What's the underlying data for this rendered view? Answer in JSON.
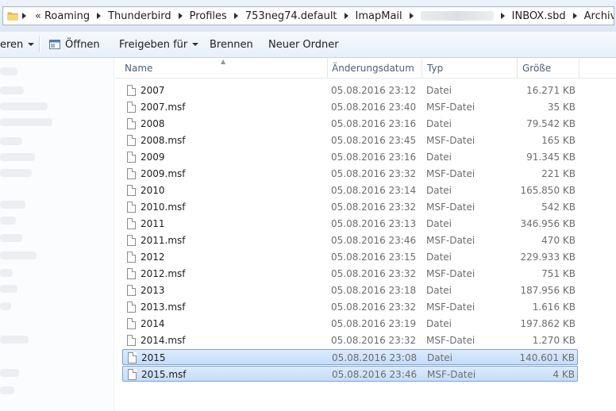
{
  "address": {
    "overflow_chevron": "«",
    "crumbs": [
      "Roaming",
      "Thunderbird",
      "Profiles",
      "753neg74.default",
      "ImapMail",
      "",
      "INBOX.sbd",
      "Archives.sbd"
    ]
  },
  "toolbar": {
    "organize_partial": "eren",
    "open_label": "Öffnen",
    "share_label": "Freigeben für",
    "burn_label": "Brennen",
    "new_folder_label": "Neuer Ordner"
  },
  "columns": {
    "name": "Name",
    "date": "Änderungsdatum",
    "type": "Typ",
    "size": "Größe"
  },
  "files": [
    {
      "name": "2007",
      "date": "05.08.2016 23:12",
      "type": "Datei",
      "size": "16.271 KB",
      "selected": false
    },
    {
      "name": "2007.msf",
      "date": "05.08.2016 23:40",
      "type": "MSF-Datei",
      "size": "35 KB",
      "selected": false
    },
    {
      "name": "2008",
      "date": "05.08.2016 23:16",
      "type": "Datei",
      "size": "79.542 KB",
      "selected": false
    },
    {
      "name": "2008.msf",
      "date": "05.08.2016 23:45",
      "type": "MSF-Datei",
      "size": "165 KB",
      "selected": false
    },
    {
      "name": "2009",
      "date": "05.08.2016 23:16",
      "type": "Datei",
      "size": "91.345 KB",
      "selected": false
    },
    {
      "name": "2009.msf",
      "date": "05.08.2016 23:32",
      "type": "MSF-Datei",
      "size": "221 KB",
      "selected": false
    },
    {
      "name": "2010",
      "date": "05.08.2016 23:14",
      "type": "Datei",
      "size": "165.850 KB",
      "selected": false
    },
    {
      "name": "2010.msf",
      "date": "05.08.2016 23:32",
      "type": "MSF-Datei",
      "size": "542 KB",
      "selected": false
    },
    {
      "name": "2011",
      "date": "05.08.2016 23:13",
      "type": "Datei",
      "size": "346.956 KB",
      "selected": false
    },
    {
      "name": "2011.msf",
      "date": "05.08.2016 23:46",
      "type": "MSF-Datei",
      "size": "470 KB",
      "selected": false
    },
    {
      "name": "2012",
      "date": "05.08.2016 23:15",
      "type": "Datei",
      "size": "229.933 KB",
      "selected": false
    },
    {
      "name": "2012.msf",
      "date": "05.08.2016 23:32",
      "type": "MSF-Datei",
      "size": "751 KB",
      "selected": false
    },
    {
      "name": "2013",
      "date": "05.08.2016 23:18",
      "type": "Datei",
      "size": "187.956 KB",
      "selected": false
    },
    {
      "name": "2013.msf",
      "date": "05.08.2016 23:32",
      "type": "MSF-Datei",
      "size": "1.616 KB",
      "selected": false
    },
    {
      "name": "2014",
      "date": "05.08.2016 23:19",
      "type": "Datei",
      "size": "197.862 KB",
      "selected": false
    },
    {
      "name": "2014.msf",
      "date": "05.08.2016 23:32",
      "type": "MSF-Datei",
      "size": "1.270 KB",
      "selected": false
    },
    {
      "name": "2015",
      "date": "05.08.2016 23:08",
      "type": "Datei",
      "size": "140.601 KB",
      "selected": true
    },
    {
      "name": "2015.msf",
      "date": "05.08.2016 23:46",
      "type": "MSF-Datei",
      "size": "4 KB",
      "selected": true
    }
  ]
}
